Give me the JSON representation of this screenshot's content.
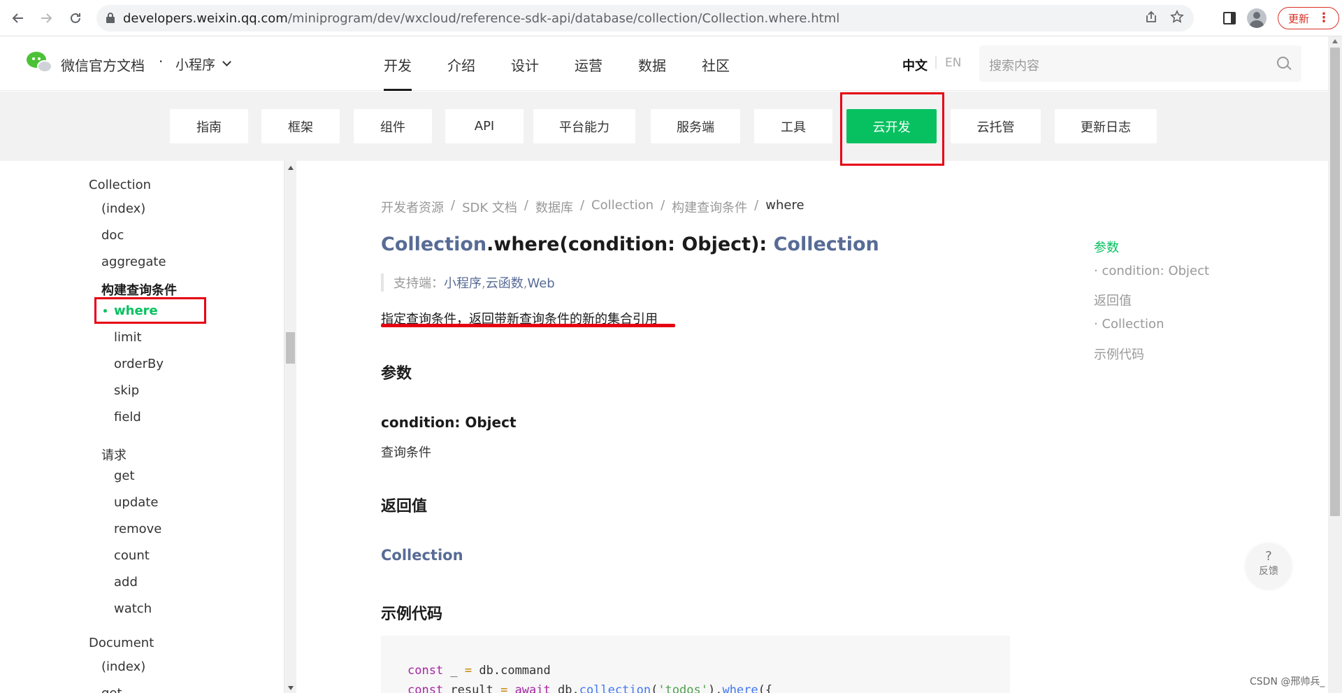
{
  "browser": {
    "url_host": "developers.weixin.qq.com",
    "url_path": "/miniprogram/dev/wxcloud/reference-sdk-api/database/collection/Collection.where.html",
    "update_label": "更新"
  },
  "header": {
    "brand": "微信官方文档",
    "separator": "·",
    "product": "小程序",
    "nav": [
      "开发",
      "介绍",
      "设计",
      "运营",
      "数据",
      "社区"
    ],
    "lang_zh": "中文",
    "lang_en": "EN",
    "search_placeholder": "搜索内容"
  },
  "subnav": {
    "tabs": [
      "指南",
      "框架",
      "组件",
      "API",
      "平台能力",
      "服务端",
      "工具",
      "云开发",
      "云托管",
      "更新日志"
    ],
    "active": "云开发"
  },
  "sidebar": {
    "items": [
      "Collection",
      "(index)",
      "doc",
      "aggregate",
      "构建查询条件",
      "where",
      "limit",
      "orderBy",
      "skip",
      "field",
      "请求",
      "get",
      "update",
      "remove",
      "count",
      "add",
      "watch",
      "Document",
      "(index)",
      "get"
    ]
  },
  "content": {
    "breadcrumbs": [
      "开发者资源",
      "SDK 文档",
      "数据库",
      "Collection",
      "构建查询条件",
      "where"
    ],
    "breadcrumb_sep": "/",
    "title_class": "Collection",
    "title_method": ".where(condition: Object): ",
    "title_return": "Collection",
    "support_label": "支持端：",
    "platforms": [
      "小程序",
      "云函数",
      "Web"
    ],
    "platform_sep": ",",
    "description": "指定查询条件，返回带新查询条件的新的集合引用",
    "h_params": "参数",
    "param_name": "condition: Object",
    "param_desc": "查询条件",
    "h_return": "返回值",
    "return_type": "Collection",
    "h_example": "示例代码",
    "code": {
      "l1_kw": "const",
      "l1_var": " _ ",
      "l1_eq": "=",
      "l1_rest": " db.command",
      "l2_kw": "const",
      "l2_var": " result ",
      "l2_eq": "=",
      "l2_await": " await",
      "l2_db": " db.",
      "l2_fn": "collection",
      "l2_p1": "(",
      "l2_str": "'todos'",
      "l2_p2": ").",
      "l2_fn2": "where",
      "l2_p3": "({"
    }
  },
  "toc": [
    "参数",
    "· condition: Object",
    "返回值",
    "· Collection",
    "示例代码"
  ],
  "feedback": {
    "q": "?",
    "label": "反馈"
  },
  "watermark": "CSDN @邢帅兵_"
}
